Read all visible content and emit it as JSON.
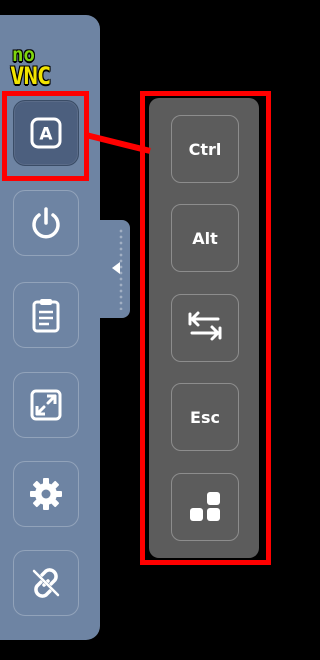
{
  "logo": {
    "part1": "no",
    "part2": "VNC"
  },
  "sidebar": {
    "buttons": [
      {
        "name": "extra-keys-button",
        "icon": "keyboard-A-icon",
        "selected": true
      },
      {
        "name": "power-button",
        "icon": "power-icon",
        "selected": false
      },
      {
        "name": "clipboard-button",
        "icon": "clipboard-icon",
        "selected": false
      },
      {
        "name": "fullscreen-button",
        "icon": "fullscreen-icon",
        "selected": false
      },
      {
        "name": "settings-button",
        "icon": "gear-icon",
        "selected": false
      },
      {
        "name": "disconnect-button",
        "icon": "disconnect-icon",
        "selected": false
      }
    ]
  },
  "extra_keys": {
    "ctrl_label": "Ctrl",
    "alt_label": "Alt",
    "tab_icon": "tab-icon",
    "esc_label": "Esc",
    "windows_icon": "ctrl-alt-del-icon"
  },
  "colors": {
    "sidebar_bg": "#6e84a3",
    "selected_bg": "#4c5f7e",
    "panel_bg": "#5c5c5c",
    "highlight": "#ff0000",
    "logo_green": "#7fd60d",
    "logo_yellow": "#f2e400"
  }
}
